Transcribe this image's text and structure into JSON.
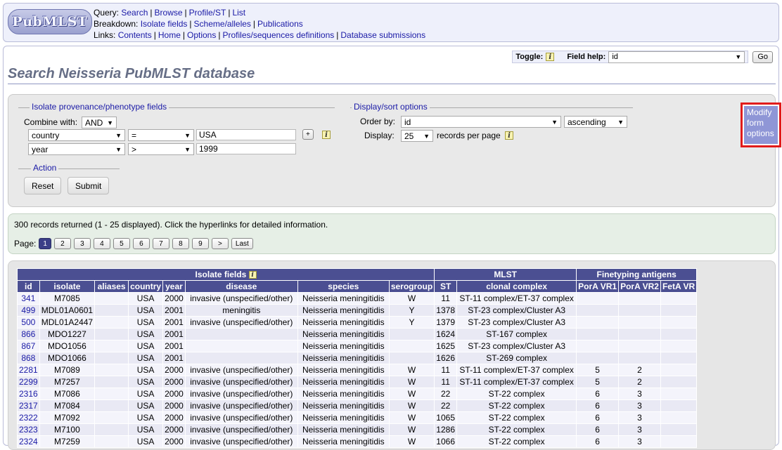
{
  "header": {
    "logo_text": "PubMLST",
    "query_label": "Query:",
    "query_links": [
      "Search",
      "Browse",
      "Profile/ST",
      "List"
    ],
    "breakdown_label": "Breakdown:",
    "breakdown_links": [
      "Isolate fields",
      "Scheme/alleles",
      "Publications"
    ],
    "links_label": "Links:",
    "links_links": [
      "Contents",
      "Home",
      "Options",
      "Profiles/sequences definitions",
      "Database submissions"
    ]
  },
  "toolbar": {
    "toggle_label": "Toggle:",
    "field_help_label": "Field help:",
    "field_help_value": "id",
    "go_label": "Go"
  },
  "page_title": "Search Neisseria PubMLST database",
  "form": {
    "provenance_legend": "Isolate provenance/phenotype fields",
    "combine_label": "Combine with:",
    "combine_value": "AND",
    "rows": [
      {
        "field": "country",
        "operator": "=",
        "value": "USA"
      },
      {
        "field": "year",
        "operator": ">",
        "value": "1999"
      }
    ],
    "add_label": "+",
    "display_legend": "Display/sort options",
    "order_by_label": "Order by:",
    "order_by_value": "id",
    "order_dir_value": "ascending",
    "display_label": "Display:",
    "display_value": "25",
    "records_per_page": "records per page",
    "action_legend": "Action",
    "reset_label": "Reset",
    "submit_label": "Submit",
    "modify_label": "Modify form options"
  },
  "results": {
    "summary": "300 records returned (1 - 25 displayed). Click the hyperlinks for detailed information.",
    "page_label": "Page:",
    "pages": [
      "1",
      "2",
      "3",
      "4",
      "5",
      "6",
      "7",
      "8",
      "9"
    ],
    "next_label": ">",
    "last_label": "Last"
  },
  "table": {
    "group_headers": {
      "isolate": "Isolate fields",
      "mlst": "MLST",
      "fine": "Finetyping antigens"
    },
    "columns": [
      "id",
      "isolate",
      "aliases",
      "country",
      "year",
      "disease",
      "species",
      "serogroup",
      "ST",
      "clonal complex",
      "PorA VR1",
      "PorA VR2",
      "FetA VR"
    ],
    "rows": [
      [
        "341",
        "M7085",
        "",
        "USA",
        "2000",
        "invasive (unspecified/other)",
        "Neisseria meningitidis",
        "W",
        "11",
        "ST-11 complex/ET-37 complex",
        "",
        "",
        ""
      ],
      [
        "499",
        "MDL01A0601",
        "",
        "USA",
        "2001",
        "meningitis",
        "Neisseria meningitidis",
        "Y",
        "1378",
        "ST-23 complex/Cluster A3",
        "",
        "",
        ""
      ],
      [
        "500",
        "MDL01A2447",
        "",
        "USA",
        "2001",
        "invasive (unspecified/other)",
        "Neisseria meningitidis",
        "Y",
        "1379",
        "ST-23 complex/Cluster A3",
        "",
        "",
        ""
      ],
      [
        "866",
        "MDO1227",
        "",
        "USA",
        "2001",
        "",
        "Neisseria meningitidis",
        "",
        "1624",
        "ST-167 complex",
        "",
        "",
        ""
      ],
      [
        "867",
        "MDO1056",
        "",
        "USA",
        "2001",
        "",
        "Neisseria meningitidis",
        "",
        "1625",
        "ST-23 complex/Cluster A3",
        "",
        "",
        ""
      ],
      [
        "868",
        "MDO1066",
        "",
        "USA",
        "2001",
        "",
        "Neisseria meningitidis",
        "",
        "1626",
        "ST-269 complex",
        "",
        "",
        ""
      ],
      [
        "2281",
        "M7089",
        "",
        "USA",
        "2000",
        "invasive (unspecified/other)",
        "Neisseria meningitidis",
        "W",
        "11",
        "ST-11 complex/ET-37 complex",
        "5",
        "2",
        ""
      ],
      [
        "2299",
        "M7257",
        "",
        "USA",
        "2000",
        "invasive (unspecified/other)",
        "Neisseria meningitidis",
        "W",
        "11",
        "ST-11 complex/ET-37 complex",
        "5",
        "2",
        ""
      ],
      [
        "2316",
        "M7086",
        "",
        "USA",
        "2000",
        "invasive (unspecified/other)",
        "Neisseria meningitidis",
        "W",
        "22",
        "ST-22 complex",
        "6",
        "3",
        ""
      ],
      [
        "2317",
        "M7084",
        "",
        "USA",
        "2000",
        "invasive (unspecified/other)",
        "Neisseria meningitidis",
        "W",
        "22",
        "ST-22 complex",
        "6",
        "3",
        ""
      ],
      [
        "2322",
        "M7092",
        "",
        "USA",
        "2000",
        "invasive (unspecified/other)",
        "Neisseria meningitidis",
        "W",
        "1065",
        "ST-22 complex",
        "6",
        "3",
        ""
      ],
      [
        "2323",
        "M7100",
        "",
        "USA",
        "2000",
        "invasive (unspecified/other)",
        "Neisseria meningitidis",
        "W",
        "1286",
        "ST-22 complex",
        "6",
        "3",
        ""
      ],
      [
        "2324",
        "M7259",
        "",
        "USA",
        "2000",
        "invasive (unspecified/other)",
        "Neisseria meningitidis",
        "W",
        "1066",
        "ST-22 complex",
        "6",
        "3",
        ""
      ]
    ]
  }
}
